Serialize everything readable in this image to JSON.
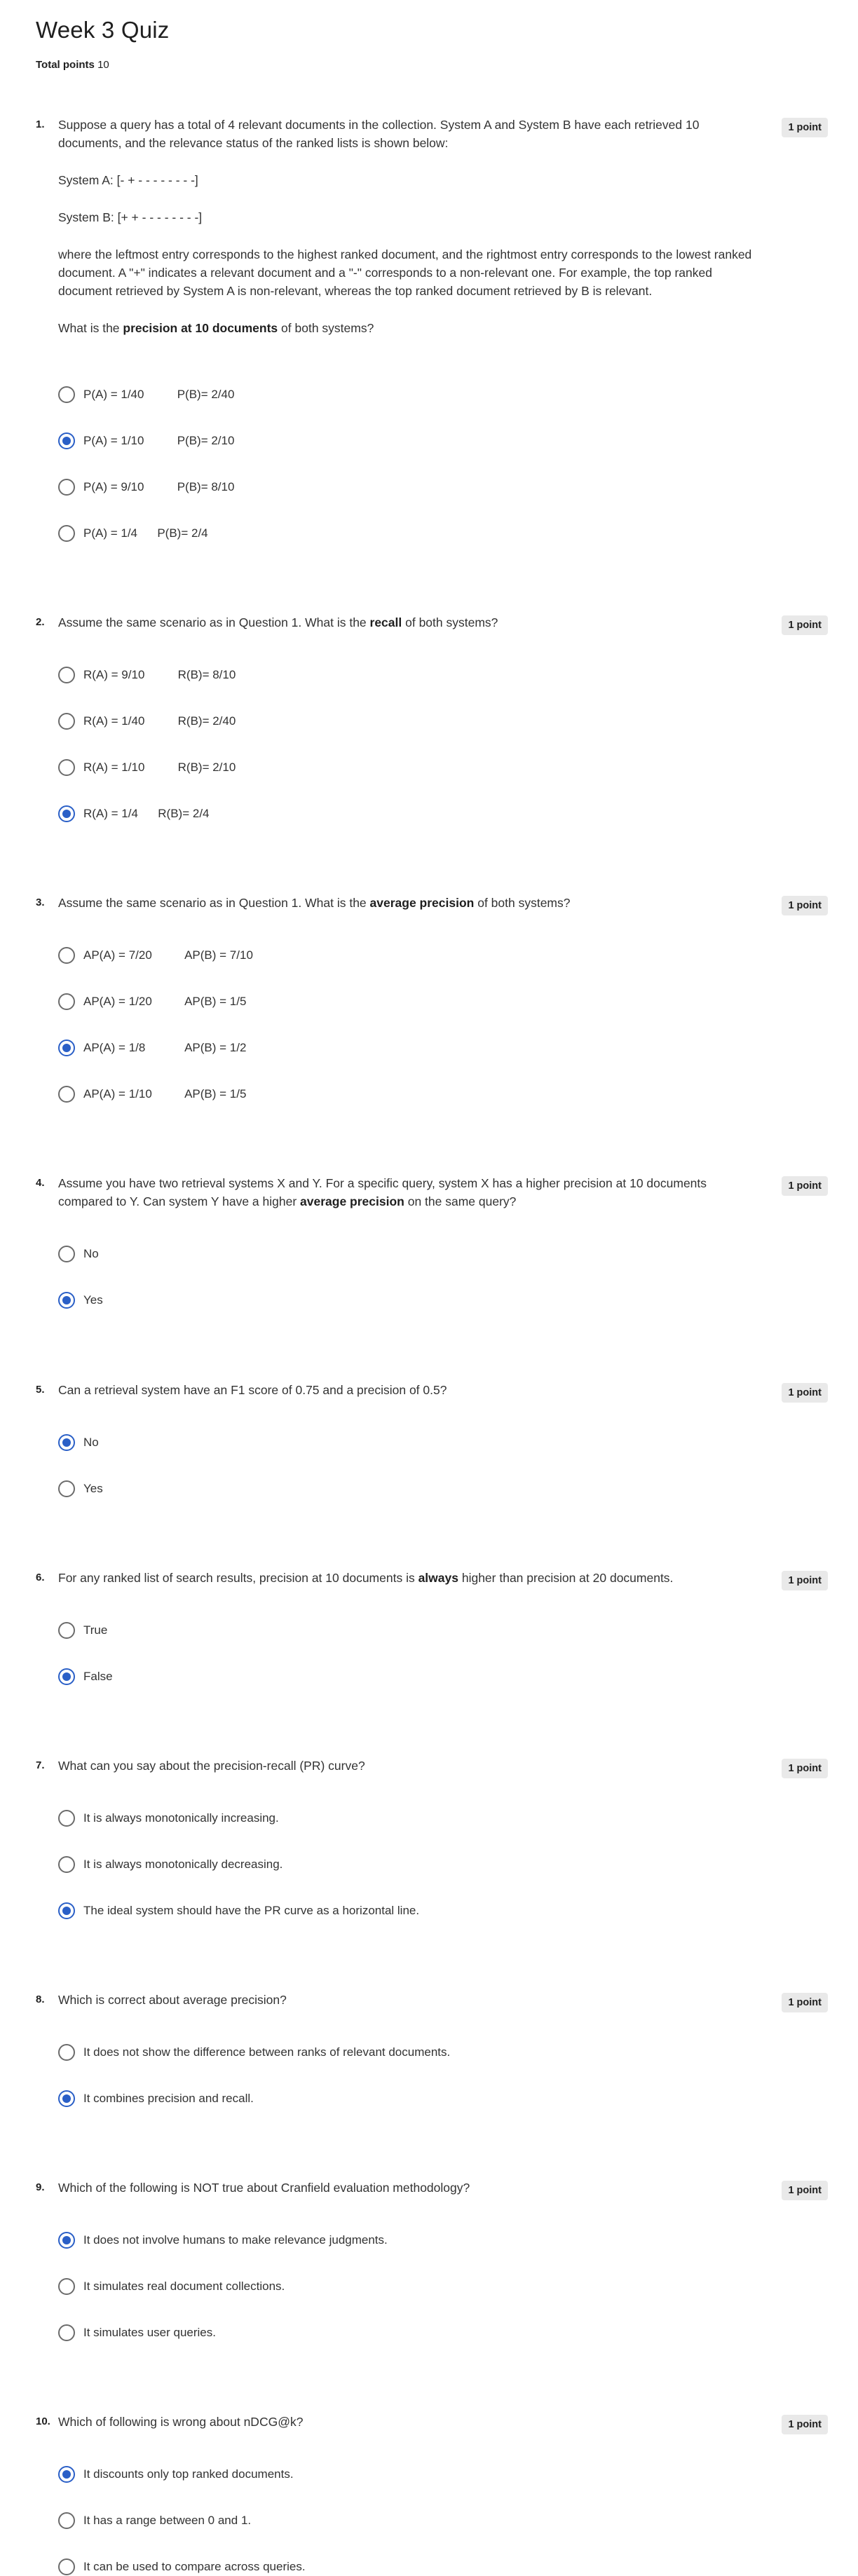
{
  "title": "Week 3 Quiz",
  "total_points_label": "Total points",
  "total_points_value": "10",
  "questions": [
    {
      "number": "1.",
      "points": "1 point",
      "paragraphs": [
        "Suppose a query has a total of 4 relevant documents in the collection. System A and System B have each retrieved 10 documents, and the relevance status of the ranked lists is shown below:",
        "System A: [- + - - - - - - - -]",
        "System B: [+ + - - - - - - - -]",
        "where the leftmost entry corresponds to the highest ranked document, and the rightmost entry corresponds to the lowest ranked document. A \"+\" indicates a relevant document and a \"-\" corresponds to a non-relevant one. For example, the top ranked document retrieved by System A is non-relevant, whereas the top ranked document retrieved by B is relevant."
      ],
      "prompt_pre": "What is the ",
      "prompt_bold": "precision at 10 documents",
      "prompt_post": " of both systems?",
      "options": [
        {
          "text": "P(A) = 1/40          P(B)= 2/40",
          "selected": false
        },
        {
          "text": "P(A) = 1/10          P(B)= 2/10",
          "selected": true
        },
        {
          "text": "P(A) = 9/10          P(B)= 8/10",
          "selected": false
        },
        {
          "text": "P(A) = 1/4      P(B)= 2/4",
          "selected": false
        }
      ]
    },
    {
      "number": "2.",
      "points": "1 point",
      "prompt_pre": "Assume the same scenario as in Question 1. What is the ",
      "prompt_bold": "recall",
      "prompt_post": " of both systems?",
      "options": [
        {
          "text": "R(A) = 9/10          R(B)= 8/10",
          "selected": false
        },
        {
          "text": "R(A) = 1/40          R(B)= 2/40",
          "selected": false
        },
        {
          "text": "R(A) = 1/10          R(B)= 2/10",
          "selected": false
        },
        {
          "text": "R(A) = 1/4      R(B)= 2/4",
          "selected": true
        }
      ]
    },
    {
      "number": "3.",
      "points": "1 point",
      "prompt_pre": "Assume the same scenario as in Question 1. What is the ",
      "prompt_bold": "average precision",
      "prompt_post": " of both systems?",
      "options": [
        {
          "text": "AP(A) = 7/20          AP(B) = 7/10",
          "selected": false
        },
        {
          "text": "AP(A) = 1/20          AP(B) = 1/5",
          "selected": false
        },
        {
          "text": "AP(A) = 1/8            AP(B) = 1/2",
          "selected": true
        },
        {
          "text": "AP(A) = 1/10          AP(B) = 1/5",
          "selected": false
        }
      ]
    },
    {
      "number": "4.",
      "points": "1 point",
      "prompt_pre": "Assume you have two retrieval systems X and Y. For a specific query, system X has a higher precision at 10 documents compared to Y. Can system Y have a higher ",
      "prompt_bold": "average precision",
      "prompt_post": " on the same query?",
      "options": [
        {
          "text": "No",
          "selected": false
        },
        {
          "text": "Yes",
          "selected": true
        }
      ]
    },
    {
      "number": "5.",
      "points": "1 point",
      "prompt_pre": "Can a retrieval system have an F1 score of 0.75 and a precision of 0.5?",
      "prompt_bold": "",
      "prompt_post": "",
      "options": [
        {
          "text": "No",
          "selected": true
        },
        {
          "text": "Yes",
          "selected": false
        }
      ]
    },
    {
      "number": "6.",
      "points": "1 point",
      "prompt_pre": "For any ranked list of search results, precision at 10 documents is ",
      "prompt_bold": "always",
      "prompt_post": " higher than precision at 20 documents.",
      "options": [
        {
          "text": "True",
          "selected": false
        },
        {
          "text": "False",
          "selected": true
        }
      ]
    },
    {
      "number": "7.",
      "points": "1 point",
      "prompt_pre": "What can you say about the precision-recall (PR) curve?",
      "prompt_bold": "",
      "prompt_post": "",
      "options": [
        {
          "text": "It is always monotonically increasing.",
          "selected": false
        },
        {
          "text": "It is always monotonically decreasing.",
          "selected": false
        },
        {
          "text": "The ideal system should have the PR curve as a horizontal line.",
          "selected": true
        }
      ]
    },
    {
      "number": "8.",
      "points": "1 point",
      "prompt_pre": "Which is correct about average precision?",
      "prompt_bold": "",
      "prompt_post": "",
      "options": [
        {
          "text": "It does not show the difference between ranks of relevant documents.",
          "selected": false
        },
        {
          "text": "It combines precision and recall.",
          "selected": true
        }
      ]
    },
    {
      "number": "9.",
      "points": "1 point",
      "prompt_pre": "Which of the following is NOT true about Cranfield evaluation methodology?",
      "prompt_bold": "",
      "prompt_post": "",
      "options": [
        {
          "text": "It does not involve humans to make relevance judgments.",
          "selected": true
        },
        {
          "text": "It simulates real document collections.",
          "selected": false
        },
        {
          "text": "It simulates user queries.",
          "selected": false
        }
      ]
    },
    {
      "number": "10.",
      "points": "1 point",
      "prompt_pre": "Which of following is wrong about nDCG@k?",
      "prompt_bold": "",
      "prompt_post": "",
      "options": [
        {
          "text": "It discounts only top ranked documents.",
          "selected": true
        },
        {
          "text": "It has a range between 0 and 1.",
          "selected": false
        },
        {
          "text": "It can be used to compare across queries.",
          "selected": false
        }
      ]
    }
  ]
}
